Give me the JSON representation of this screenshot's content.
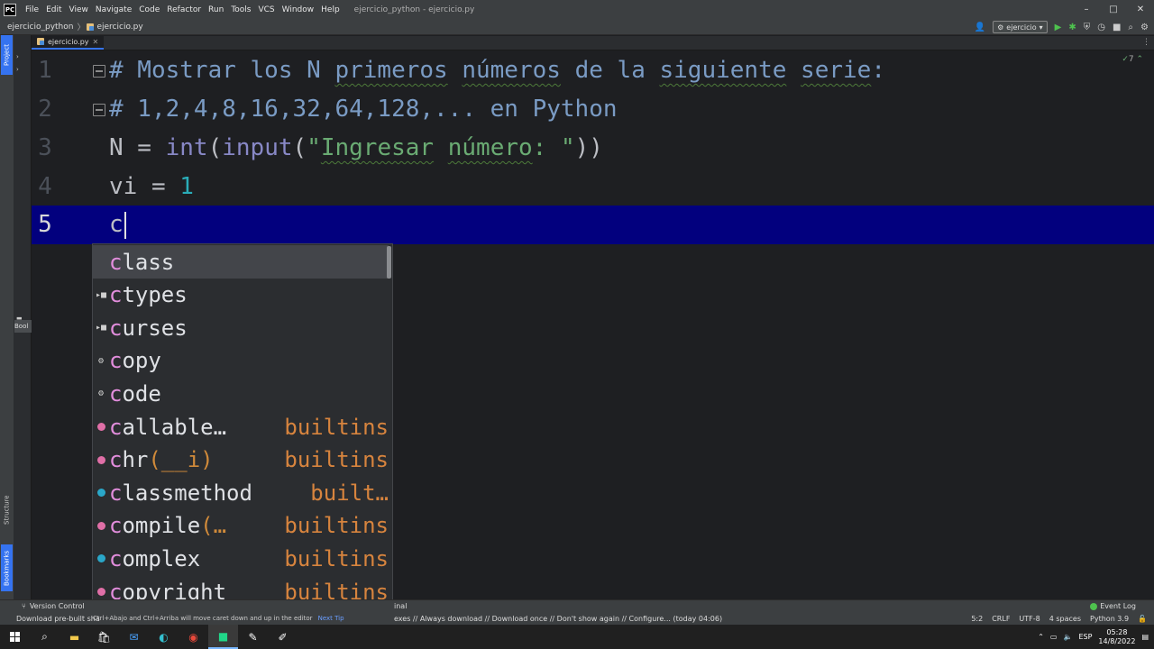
{
  "menubar": {
    "logo": "PC",
    "items": [
      "File",
      "Edit",
      "View",
      "Navigate",
      "Code",
      "Refactor",
      "Run",
      "Tools",
      "VCS",
      "Window",
      "Help"
    ],
    "title": "ejercicio_python - ejercicio.py",
    "controls": [
      "–",
      "□",
      "✕"
    ]
  },
  "navbar": {
    "project": "ejercicio_python",
    "file": "ejercicio.py",
    "run_config": "ejercicio"
  },
  "left_strip": {
    "project_tab": "Project",
    "structure_tab": "Structure",
    "bookmarks_tab": "Bookmarks",
    "book_label": "Bool"
  },
  "tab": {
    "label": "ejercicio.py"
  },
  "editor": {
    "inspection_count": "7",
    "line_numbers": [
      "1",
      "2",
      "3",
      "4",
      "5"
    ],
    "lines": {
      "l1": "# Mostrar los N primeros números de la siguiente serie:",
      "l1_parts": [
        "# Mostrar los N ",
        "primeros",
        " ",
        "números",
        " de la ",
        "siguiente",
        " ",
        "serie",
        ":"
      ],
      "l2": "# 1,2,4,8,16,32,64,128,... en Python",
      "l3": {
        "var": "N",
        "op": " = ",
        "fn1": "int",
        "p1": "(",
        "fn2": "input",
        "p2": "(",
        "str_a": "\"",
        "str_word": "Ingresar",
        "str_sp": " ",
        "str_word2": "número",
        "str_b": ": \"",
        "close": "))"
      },
      "l4": {
        "var": "vi",
        "op": " = ",
        "num": "1"
      },
      "l5": "c"
    }
  },
  "completion": {
    "items": [
      {
        "match": "c",
        "rest": "lass",
        "args": "",
        "type": "",
        "icon": "none"
      },
      {
        "match": "c",
        "rest": "types",
        "args": "",
        "type": "",
        "icon": "package"
      },
      {
        "match": "c",
        "rest": "urses",
        "args": "",
        "type": "",
        "icon": "package"
      },
      {
        "match": "c",
        "rest": "opy",
        "args": "",
        "type": "",
        "icon": "module"
      },
      {
        "match": "c",
        "rest": "ode",
        "args": "",
        "type": "",
        "icon": "module"
      },
      {
        "match": "c",
        "rest": "allable…",
        "args": "",
        "type": "builtins",
        "icon": "function"
      },
      {
        "match": "c",
        "rest": "hr",
        "args": "(__i)",
        "type": "builtins",
        "icon": "function"
      },
      {
        "match": "c",
        "rest": "lassmethod",
        "args": "",
        "type": "built…",
        "icon": "class"
      },
      {
        "match": "c",
        "rest": "ompile",
        "args": "(…",
        "type": "builtins",
        "icon": "function"
      },
      {
        "match": "c",
        "rest": "omplex",
        "args": "",
        "type": "builtins",
        "icon": "class"
      },
      {
        "match": "c",
        "rest": "opyright",
        "args": "",
        "type": "builtins",
        "icon": "function"
      }
    ]
  },
  "bottom_toolbar": {
    "version_control": "Version Control",
    "terminal_fragment": "inal",
    "event_log": "Event Log"
  },
  "statusbar": {
    "message_left": "Download pre-built sha",
    "tip": "Ctrl+Abajo and Ctrl+Arriba will move caret down and up in the editor",
    "next_tip": "Next Tip",
    "message_right": "exes // Always download // Download once // Don't show again // Configure... (today 04:06)",
    "position": "5:2",
    "line_sep": "CRLF",
    "encoding": "UTF-8",
    "indent": "4 spaces",
    "interpreter": "Python 3.9"
  },
  "taskbar": {
    "language": "ESP",
    "time": "05:28",
    "date": "14/8/2022"
  }
}
